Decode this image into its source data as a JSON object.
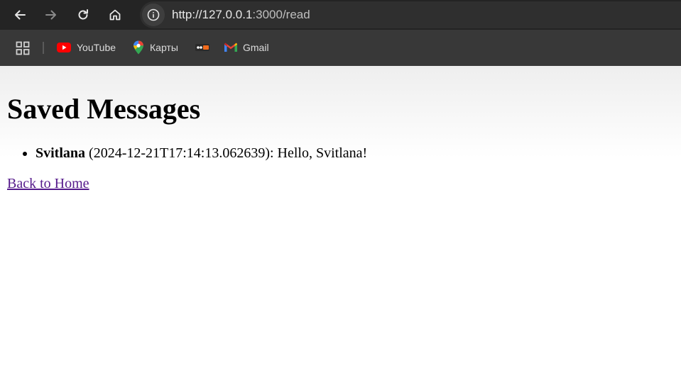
{
  "browser": {
    "url_host": "http://127.0.0.1",
    "url_rest": ":3000/read",
    "bookmarks": [
      {
        "label": "YouTube",
        "icon": "youtube-icon"
      },
      {
        "label": "Карты",
        "icon": "maps-pin-icon"
      },
      {
        "label": "",
        "icon": "site-favicon-icon"
      },
      {
        "label": "Gmail",
        "icon": "gmail-icon"
      }
    ],
    "apps_icon": "apps-grid-icon"
  },
  "page": {
    "title": "Saved Messages",
    "messages": [
      {
        "name": "Svitlana",
        "detail": " (2024-12-21T17:14:13.062639): Hello, Svitlana!"
      }
    ],
    "back_link": "Back to Home"
  },
  "colors": {
    "toolbar_bg": "#242424",
    "bookmarks_bg": "#383838",
    "visited_link": "#551a8b"
  }
}
